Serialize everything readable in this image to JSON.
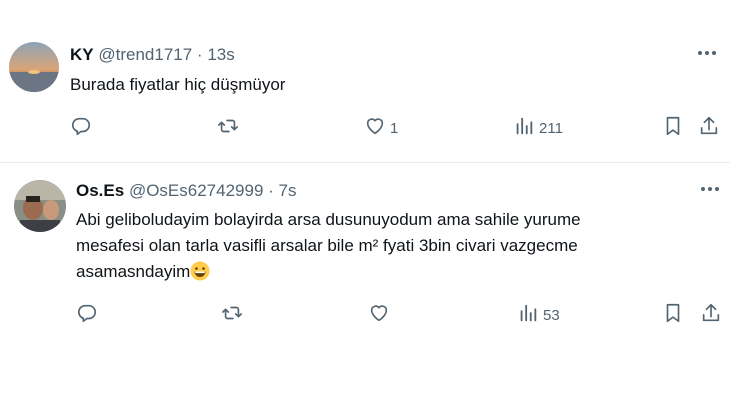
{
  "tweets": [
    {
      "name": "KY",
      "handle": "@trend1717",
      "separator": "·",
      "time": "13s",
      "text": "Burada fiyatlar hiç düşmüyor",
      "likes": "1",
      "views": "211"
    },
    {
      "name": "Os.Es",
      "handle": "@OsEs62742999",
      "separator": "·",
      "time": "7s",
      "text_line1": "Abi geliboludayim bolayirda arsa dusunuyodum ama sahile yurume",
      "text_line2": "mesafesi olan tarla vasifli arsalar bile m²  fyati 3bin civari vazgecme",
      "text_line3": "asamasndayim",
      "views": "53"
    }
  ],
  "icons": {
    "reply": "reply-icon",
    "retweet": "retweet-icon",
    "like": "heart-icon",
    "views": "views-icon",
    "bookmark": "bookmark-icon",
    "share": "share-icon",
    "more": "more-icon",
    "emoji": "grinning-emoji"
  },
  "colors": {
    "icon_gray": "#536471",
    "text": "#0f1419",
    "divider": "#e7e9ea"
  }
}
